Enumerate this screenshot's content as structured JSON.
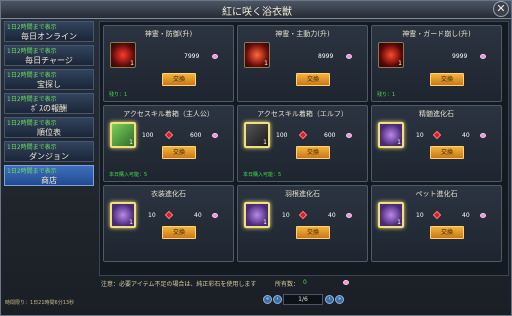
{
  "window": {
    "title": "紅に咲く浴衣獣"
  },
  "sidebar": {
    "items": [
      {
        "tag": "1日2時間まで表示",
        "label": "毎日オンライン"
      },
      {
        "tag": "1日2時間まで表示",
        "label": "毎日チャージ"
      },
      {
        "tag": "1日2時間まで表示",
        "label": "宝探し"
      },
      {
        "tag": "1日2時間まで表示",
        "label": "ﾎﾞｽの報酬"
      },
      {
        "tag": "1日2時間まで表示",
        "label": "順位表"
      },
      {
        "tag": "1日2時間まで表示",
        "label": "ダンジョン"
      },
      {
        "tag": "1日2時間まで表示",
        "label": "商店"
      }
    ],
    "active_index": 6
  },
  "cards": [
    {
      "name": "神霊・防御(升)",
      "qty": "1",
      "price": "7999",
      "button": "交換",
      "note": "残り：1",
      "currency": "pink"
    },
    {
      "name": "神霊・主動力(升)",
      "qty": "1",
      "price": "8999",
      "button": "交換",
      "note": "",
      "currency": "pink"
    },
    {
      "name": "神霊・ガード崩し(升)",
      "qty": "1",
      "price": "9999",
      "button": "交換",
      "note": "残り：1",
      "currency": "pink"
    },
    {
      "name": "アクセスキル着箱（主人公）",
      "qty": "1",
      "cost_a": "100",
      "cost_b": "600",
      "button": "交換",
      "note": "本日購入可能：5"
    },
    {
      "name": "アクセスキル着箱（エルフ）",
      "qty": "1",
      "cost_a": "100",
      "cost_b": "600",
      "button": "交換",
      "note": "本日購入可能：5"
    },
    {
      "name": "精髄進化石",
      "qty": "1",
      "cost_a": "10",
      "cost_b": "40",
      "button": "交換",
      "note": ""
    },
    {
      "name": "衣装進化石",
      "qty": "1",
      "cost_a": "10",
      "cost_b": "40",
      "button": "交換",
      "note": ""
    },
    {
      "name": "羽根進化石",
      "qty": "1",
      "cost_a": "10",
      "cost_b": "40",
      "button": "交換",
      "note": ""
    },
    {
      "name": "ペット進化石",
      "qty": "1",
      "cost_a": "10",
      "cost_b": "40",
      "button": "交換",
      "note": ""
    }
  ],
  "footer": {
    "notice": "注意：必要アイテム不足の場合は、純正彩石を使用します",
    "owned_label": "所有数：",
    "owned_value": "0",
    "page": "1/6",
    "timer": "時間限り：1日21時間6分13秒"
  },
  "colors": {
    "accent": "#f4b43a",
    "note_green": "#3fe04f",
    "active_tab": "#3d6fbe"
  }
}
